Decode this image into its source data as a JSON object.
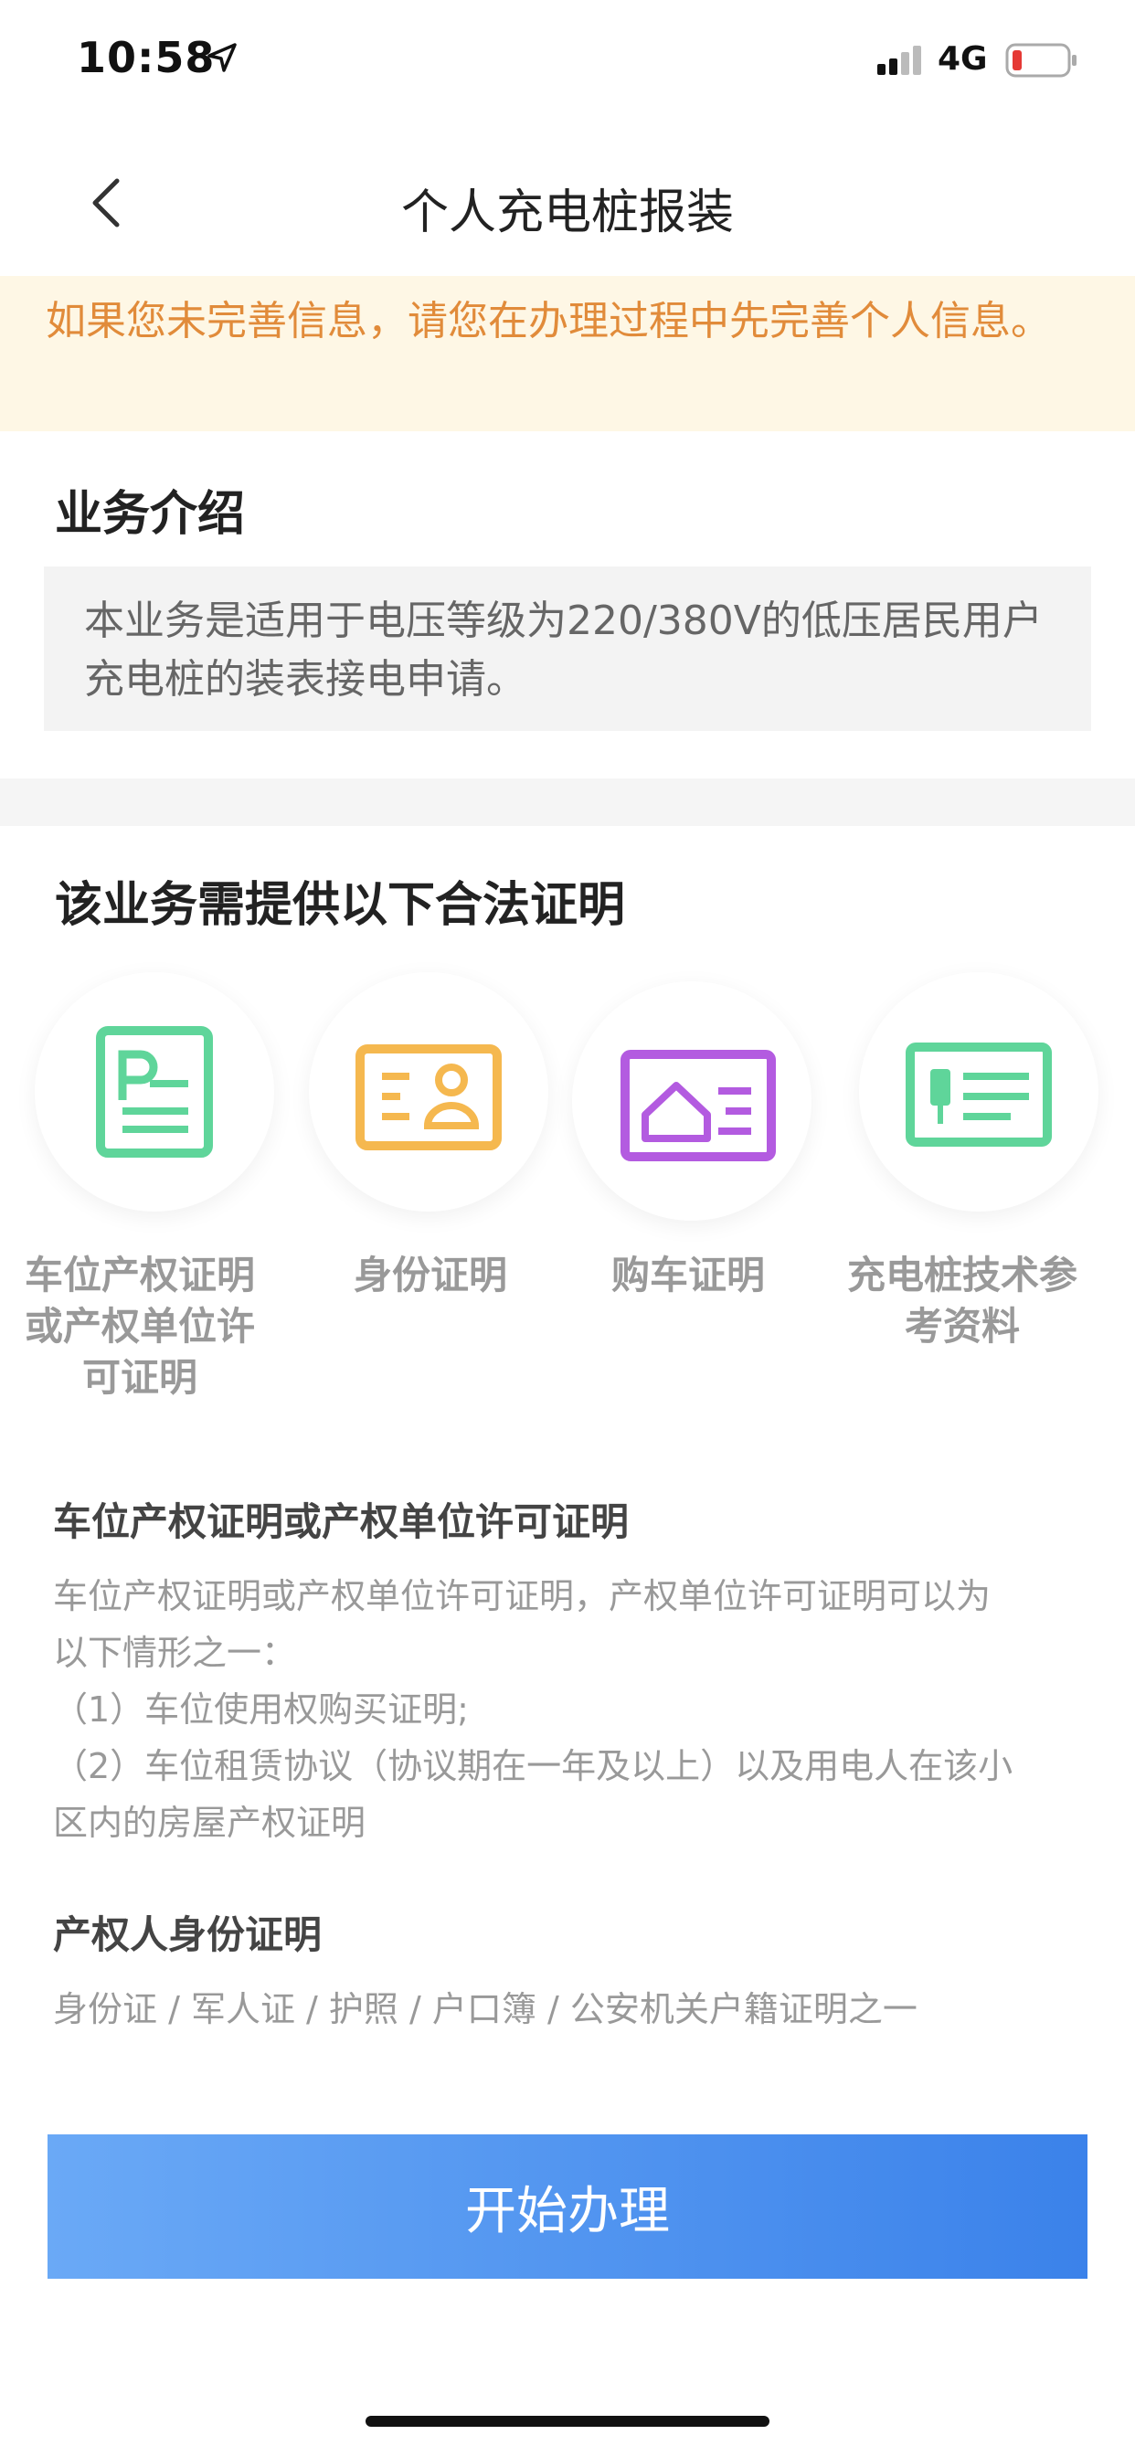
{
  "status_bar": {
    "time": "10:58",
    "network": "4G",
    "icons": [
      "location-arrow-icon",
      "signal-icon",
      "battery-low-icon"
    ]
  },
  "nav": {
    "title": "个人充电桩报装",
    "back_icon": "chevron-left-icon"
  },
  "notice": {
    "text": "如果您未完善信息，请您在办理过程中先完善个人信息。",
    "color": "#e18b3a"
  },
  "intro": {
    "title": "业务介绍",
    "text": "本业务是适用于电压等级为220/380V的低压居民用户充电桩的装表接电申请。"
  },
  "documents": {
    "title": "该业务需提供以下合法证明",
    "items": [
      {
        "label_line1": "车位产权证明",
        "label_line2": "或产权单位许",
        "label_line3": "可证明",
        "icon": "property-certificate-icon",
        "color": "#5fd59a"
      },
      {
        "label_line1": "身份证明",
        "icon": "id-card-icon",
        "color": "#f5b84f"
      },
      {
        "label_line1": "购车证明",
        "icon": "house-card-icon",
        "color": "#b35be0"
      },
      {
        "label_line1": "充电桩技术参",
        "label_line2": "考资料",
        "icon": "charger-doc-icon",
        "color": "#5fd59a"
      }
    ]
  },
  "details": [
    {
      "title": "车位产权证明或产权单位许可证明",
      "lines": [
        "车位产权证明或产权单位许可证明，产权单位许可证明可以为",
        "以下情形之一：",
        "（1）车位使用权购买证明;",
        "（2）车位租赁协议（协议期在一年及以上）以及用电人在该小",
        "区内的房屋产权证明"
      ]
    },
    {
      "title": "产权人身份证明",
      "lines": [
        "身份证 / 军人证 / 护照 / 户口簿 / 公安机关户籍证明之一"
      ]
    }
  ],
  "button": {
    "label": "开始办理"
  }
}
